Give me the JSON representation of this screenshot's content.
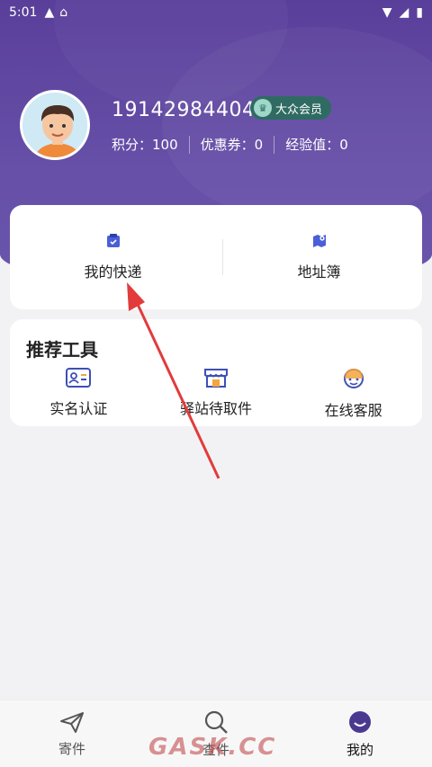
{
  "status_bar": {
    "time": "5:01"
  },
  "profile": {
    "phone": "19142984404",
    "member_badge": "大众会员",
    "points_label": "积分：",
    "points_value": "100",
    "coupons_label": "优惠券：",
    "coupons_value": "0",
    "exp_label": "经验值：",
    "exp_value": "0"
  },
  "quick": {
    "my_express": "我的快递",
    "address_book": "地址簿"
  },
  "tools": {
    "title": "推荐工具",
    "items": [
      {
        "label": "实名认证",
        "icon": "id-card-icon"
      },
      {
        "label": "驿站待取件",
        "icon": "store-icon"
      },
      {
        "label": "在线客服",
        "icon": "customer-service-icon"
      }
    ]
  },
  "tabbar": {
    "items": [
      {
        "label": "寄件",
        "icon": "send-icon"
      },
      {
        "label": "查件",
        "icon": "search-icon"
      },
      {
        "label": "我的",
        "icon": "profile-icon",
        "active": true
      }
    ]
  },
  "watermark": "GASK.CC",
  "colors": {
    "brand": "#5a3f9a",
    "badge": "#2f6b63",
    "arrow": "#e23b3b",
    "accent_icon": "#4a5fd8"
  }
}
